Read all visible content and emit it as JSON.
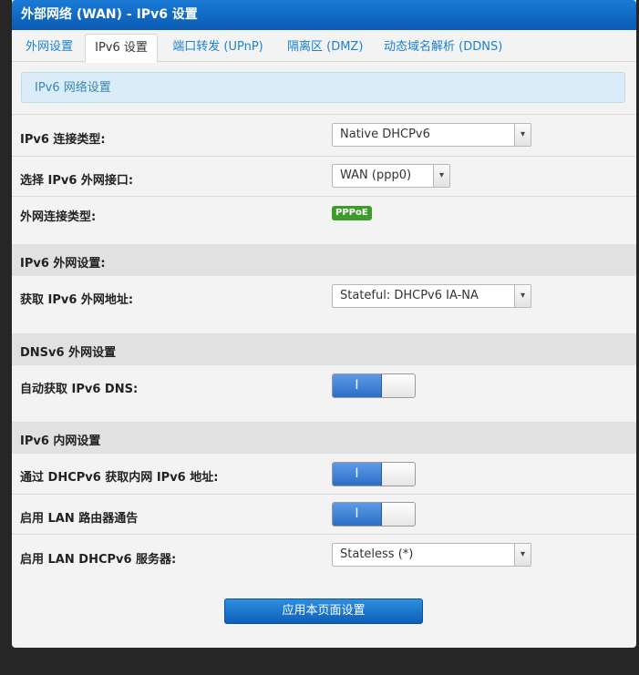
{
  "window": {
    "title": "外部网络 (WAN) - IPv6 设置"
  },
  "tabs": [
    {
      "label": "外网设置"
    },
    {
      "label": "IPv6 设置"
    },
    {
      "label": "端口转发 (UPnP)"
    },
    {
      "label": "隔离区 (DMZ)"
    },
    {
      "label": "动态域名解析 (DDNS)"
    }
  ],
  "infobox": {
    "text": "IPv6 网络设置"
  },
  "fields": {
    "conn_type": {
      "label": "IPv6 连接类型:",
      "value": "Native DHCPv6"
    },
    "wan_iface": {
      "label": "选择 IPv6 外网接口:",
      "value": "WAN (ppp0)"
    },
    "wan_type": {
      "label": "外网连接类型:",
      "badge": "PPPoE"
    },
    "wan_addr": {
      "label": "获取 IPv6 外网地址:",
      "value": "Stateful: DHCPv6 IA-NA"
    },
    "auto_dns": {
      "label": "自动获取 IPv6 DNS:",
      "toggle": "I"
    },
    "lan_dhcp": {
      "label": "通过 DHCPv6 获取内网 IPv6 地址:",
      "toggle": "I"
    },
    "lan_ra": {
      "label": "启用 LAN 路由器通告",
      "toggle": "I"
    },
    "lan_server": {
      "label": "启用 LAN DHCPv6 服务器:",
      "value": "Stateless (*)"
    }
  },
  "sections": {
    "wan": "IPv6 外网设置:",
    "dns": "DNSv6 外网设置",
    "lan": "IPv6 内网设置"
  },
  "select_arrow": "▾",
  "apply_button": {
    "label": "应用本页面设置"
  },
  "colors": {
    "accent": "#0a5bb3",
    "tab_link": "#1a82cf",
    "badge": "#3d9c2c",
    "toggle_on": "#2b6ec7"
  }
}
